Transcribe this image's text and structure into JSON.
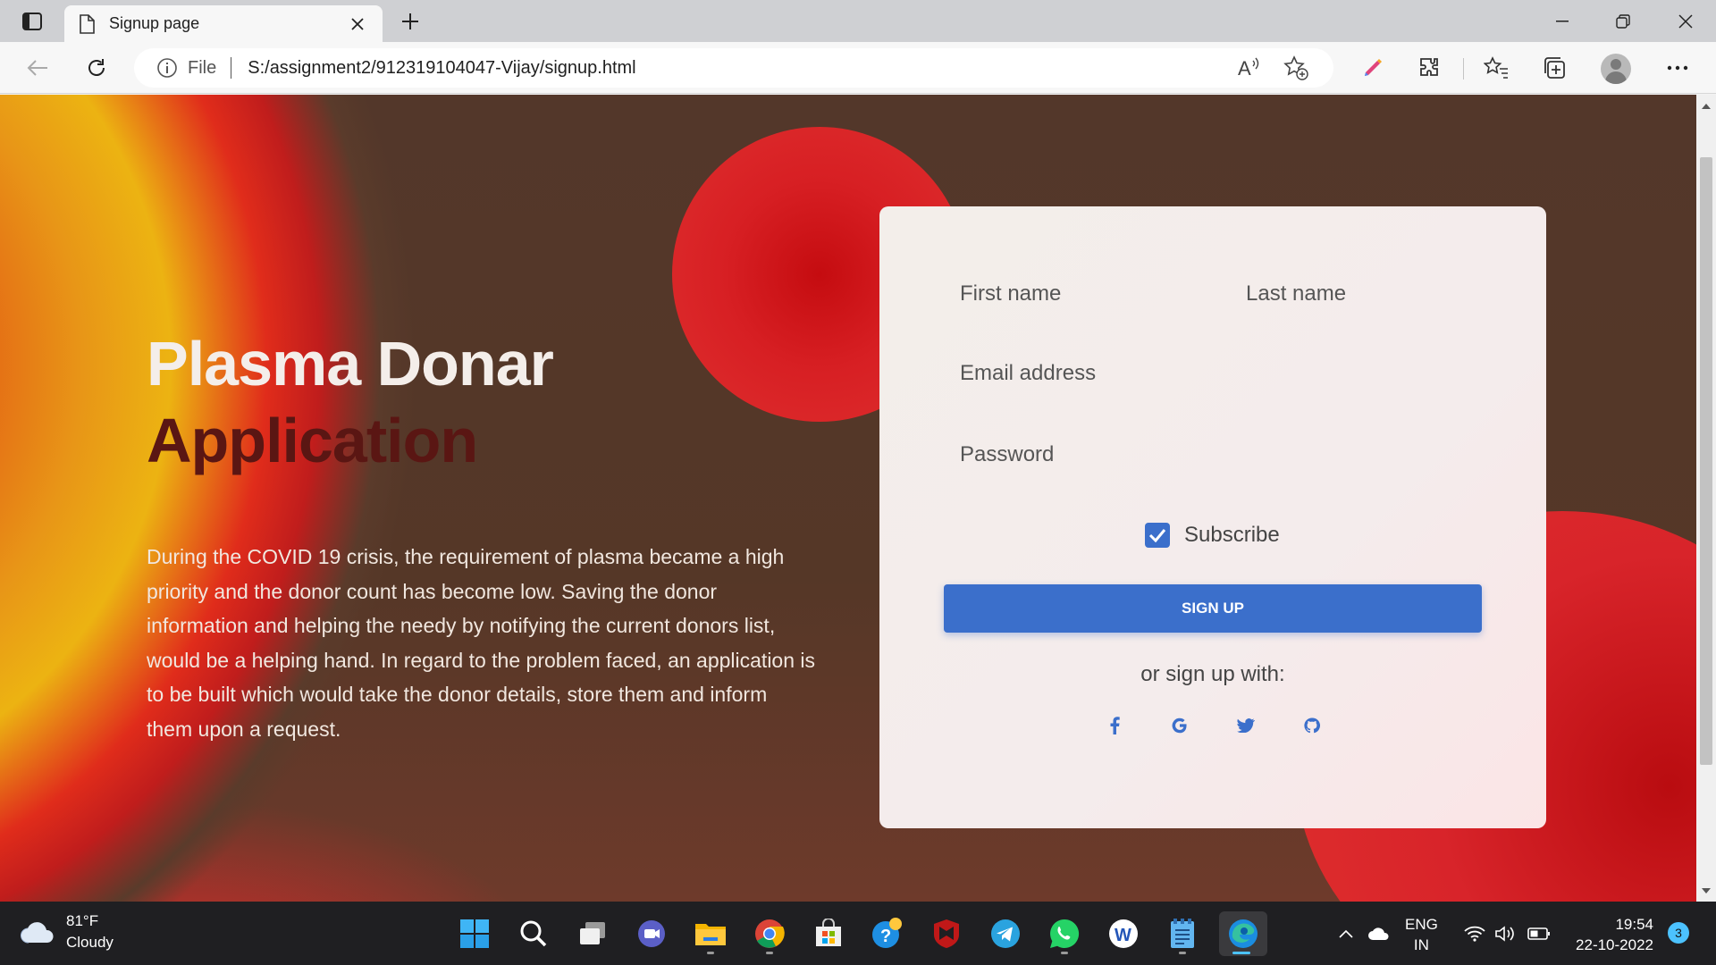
{
  "browser": {
    "tab_title": "Signup page",
    "omnibox": {
      "scheme": "File",
      "url": "S:/assignment2/912319104047-Vijay/signup.html"
    }
  },
  "page": {
    "heading_line1": "Plasma Donar",
    "heading_line2": "Application",
    "description": "During the COVID 19 crisis, the requirement of plasma became a high priority and the donor count has become low. Saving the donor information and helping the needy by notifying the current donors list, would be a helping hand. In regard to the problem faced, an application is to be built which would take the donor details, store them and inform them upon a request.",
    "form": {
      "first_name_placeholder": "First name",
      "last_name_placeholder": "Last name",
      "email_placeholder": "Email address",
      "password_placeholder": "Password",
      "subscribe_label": "Subscribe",
      "subscribe_checked": true,
      "signup_label": "SIGN UP",
      "or_signup_with": "or sign up with:",
      "social": [
        "facebook-icon",
        "google-icon",
        "twitter-icon",
        "github-icon"
      ]
    },
    "colors": {
      "accent": "#3b6fcb",
      "heading_dark": "#5a1613"
    }
  },
  "taskbar": {
    "weather_temp": "81°F",
    "weather_desc": "Cloudy",
    "lang_top": "ENG",
    "lang_bottom": "IN",
    "time": "19:54",
    "date": "22-10-2022",
    "notifications": "3"
  }
}
